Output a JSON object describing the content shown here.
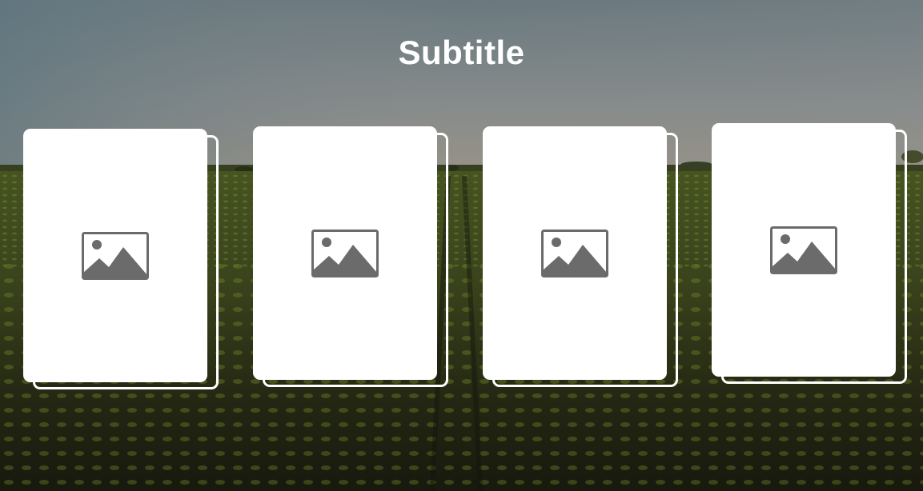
{
  "section": {
    "title": "Subtitle"
  },
  "background": {
    "description_icon": "farm-field-photo",
    "sky_color": "#8a9294",
    "field_color": "#3d4a1f"
  },
  "cards": [
    {
      "icon": "image-placeholder-icon"
    },
    {
      "icon": "image-placeholder-icon"
    },
    {
      "icon": "image-placeholder-icon"
    },
    {
      "icon": "image-placeholder-icon"
    }
  ],
  "colors": {
    "card_background": "#ffffff",
    "icon_color": "#6b6b6b",
    "title_color": "#ffffff"
  }
}
